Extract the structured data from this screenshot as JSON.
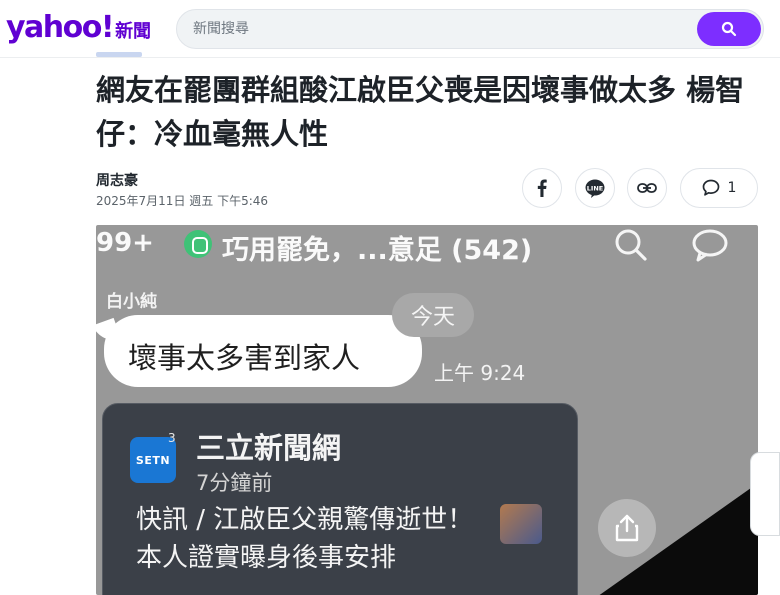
{
  "header": {
    "logo": "yahoo!",
    "logo_sub": "新聞",
    "search_placeholder": "新聞搜尋"
  },
  "article": {
    "title": "網友在罷團群組酸江啟臣父喪是因壞事做太多 楊智仔：冷血毫無人性",
    "author": "周志豪",
    "date": "2025年7月11日 週五 下午5:46",
    "comment_count": "1"
  },
  "share_icons": [
    "facebook-icon",
    "line-icon",
    "link-icon",
    "comment-icon"
  ],
  "photo": {
    "unread_count": "99+",
    "chat_name": "巧用罷免，...意足 (542)",
    "sender": "白小純",
    "message": "壞事太多害到家人",
    "day_label": "今天",
    "time": "上午 9:24",
    "card_app_icon": "SETN",
    "card_badge": "3",
    "card_title": "三立新聞網",
    "card_sub": "7分鐘前",
    "card_body": "快訊 / 江啟臣父親驚傳逝世！本人證實曝身後事安排"
  },
  "colors": {
    "brand": "#6001d2",
    "search_button": "#7d2eff"
  }
}
